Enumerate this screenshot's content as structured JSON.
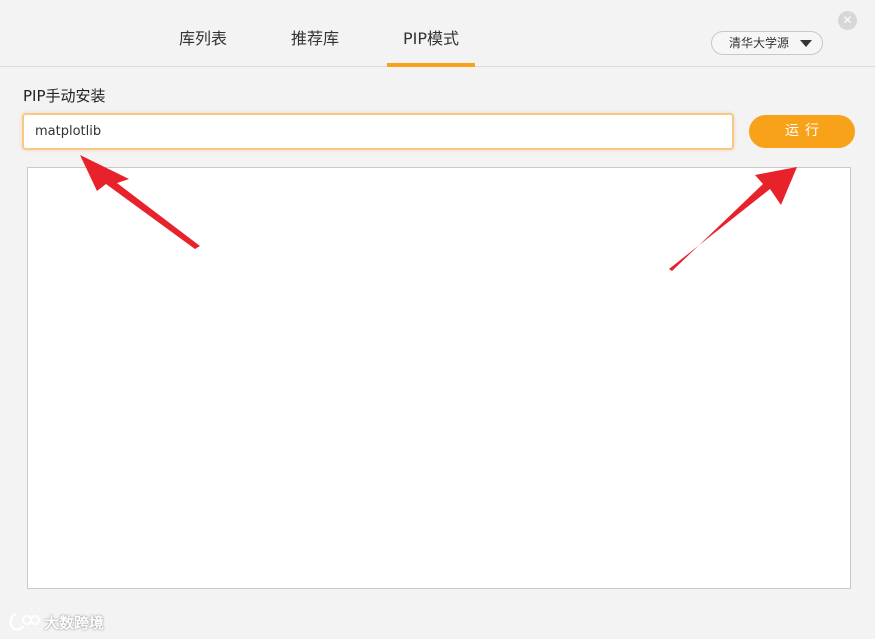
{
  "tabs": [
    {
      "label": "库列表",
      "active": false
    },
    {
      "label": "推荐库",
      "active": false
    },
    {
      "label": "PIP模式",
      "active": true
    }
  ],
  "source": {
    "selected": "清华大学源"
  },
  "window": {
    "close_icon": "close-icon"
  },
  "pip": {
    "section_title": "PIP手动安装",
    "input_value": "matplotlib",
    "run_label": "运行"
  },
  "output": {
    "text": ""
  },
  "annotations": {
    "arrow_color": "#e8222a",
    "count": 2
  },
  "watermark": {
    "text": "大数跨境"
  },
  "colors": {
    "accent": "#f8a21a",
    "input_border": "#f7c987",
    "background": "#f3f3f3"
  }
}
